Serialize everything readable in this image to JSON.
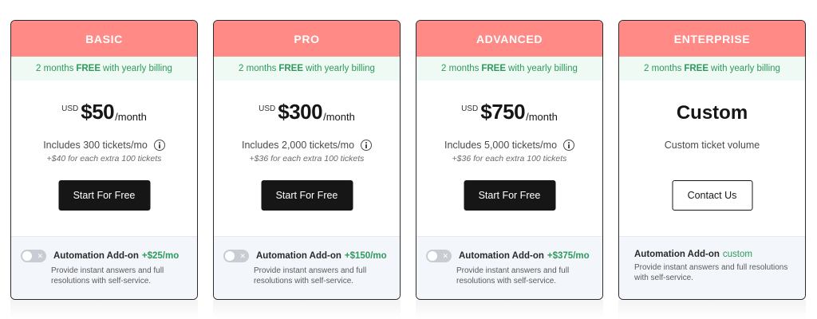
{
  "promo": {
    "prefix": "2 months",
    "highlight": "FREE",
    "suffix": "with yearly billing"
  },
  "plans": [
    {
      "name": "BASIC",
      "currency": "USD",
      "amount": "$50",
      "period": "/month",
      "includes": "Includes 300 tickets/mo",
      "extra": "+$40 for each extra 100 tickets",
      "cta": "Start For Free",
      "addon_title": "Automation Add-on",
      "addon_price": "+$25/mo",
      "addon_desc": "Provide instant answers and full resolutions with self-service."
    },
    {
      "name": "PRO",
      "currency": "USD",
      "amount": "$300",
      "period": "/month",
      "includes": "Includes 2,000 tickets/mo",
      "extra": "+$36 for each extra 100 tickets",
      "cta": "Start For Free",
      "addon_title": "Automation Add-on",
      "addon_price": "+$150/mo",
      "addon_desc": "Provide instant answers and full resolutions with self-service."
    },
    {
      "name": "ADVANCED",
      "currency": "USD",
      "amount": "$750",
      "period": "/month",
      "includes": "Includes 5,000 tickets/mo",
      "extra": "+$36 for each extra 100 tickets",
      "cta": "Start For Free",
      "addon_title": "Automation Add-on",
      "addon_price": "+$375/mo",
      "addon_desc": "Provide instant answers and full resolutions with self-service."
    },
    {
      "name": "ENTERPRISE",
      "title": "Custom",
      "includes": "Custom ticket volume",
      "cta": "Contact Us",
      "addon_title": "Automation Add-on",
      "addon_price": "custom",
      "addon_desc": "Provide instant answers and full resolutions with self-service."
    }
  ],
  "icons": {
    "info": "info-circle-icon",
    "toggle": "toggle-off-icon"
  },
  "colors": {
    "header": "#ff8a86",
    "promo_bg": "#eefaf3",
    "promo_text": "#2f9a5d",
    "addon_bg": "#f3f6fb",
    "dark_button": "#161616"
  }
}
